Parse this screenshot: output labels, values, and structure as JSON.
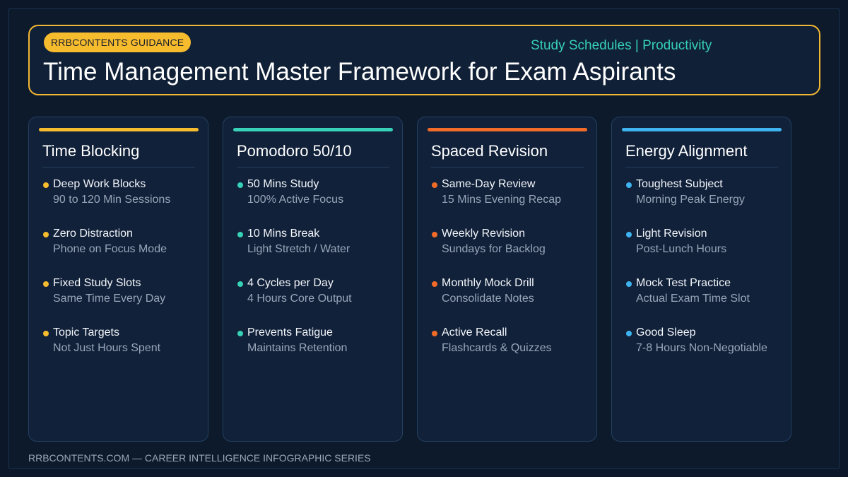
{
  "header": {
    "badge": "RRBCONTENTS GUIDANCE",
    "tags": "Study Schedules | Productivity",
    "title": "Time Management Master Framework for Exam Aspirants"
  },
  "colors": {
    "accent_yellow": "#f7bb2e",
    "accent_teal": "#36d1b6",
    "accent_orange": "#f06a28",
    "accent_blue": "#3fb3f0"
  },
  "cards": [
    {
      "title": "Time Blocking",
      "color": "#f7bb2e",
      "items": [
        {
          "main": "Deep Work Blocks",
          "sub": "90 to 120 Min Sessions"
        },
        {
          "main": "Zero Distraction",
          "sub": "Phone on Focus Mode"
        },
        {
          "main": "Fixed Study Slots",
          "sub": "Same Time Every Day"
        },
        {
          "main": "Topic Targets",
          "sub": "Not Just Hours Spent"
        }
      ]
    },
    {
      "title": "Pomodoro 50/10",
      "color": "#36d1b6",
      "items": [
        {
          "main": "50 Mins Study",
          "sub": "100% Active Focus"
        },
        {
          "main": "10 Mins Break",
          "sub": "Light Stretch / Water"
        },
        {
          "main": "4 Cycles per Day",
          "sub": "4 Hours Core Output"
        },
        {
          "main": "Prevents Fatigue",
          "sub": "Maintains Retention"
        }
      ]
    },
    {
      "title": "Spaced Revision",
      "color": "#f06a28",
      "items": [
        {
          "main": "Same-Day Review",
          "sub": "15 Mins Evening Recap"
        },
        {
          "main": "Weekly Revision",
          "sub": "Sundays for Backlog"
        },
        {
          "main": "Monthly Mock Drill",
          "sub": "Consolidate Notes"
        },
        {
          "main": "Active Recall",
          "sub": "Flashcards & Quizzes"
        }
      ]
    },
    {
      "title": "Energy Alignment",
      "color": "#3fb3f0",
      "items": [
        {
          "main": "Toughest Subject",
          "sub": "Morning Peak Energy"
        },
        {
          "main": "Light Revision",
          "sub": "Post-Lunch Hours"
        },
        {
          "main": "Mock Test Practice",
          "sub": "Actual Exam Time Slot"
        },
        {
          "main": "Good Sleep",
          "sub": "7-8 Hours Non-Negotiable"
        }
      ]
    }
  ],
  "footer": "RRBCONTENTS.COM — CAREER INTELLIGENCE INFOGRAPHIC SERIES"
}
